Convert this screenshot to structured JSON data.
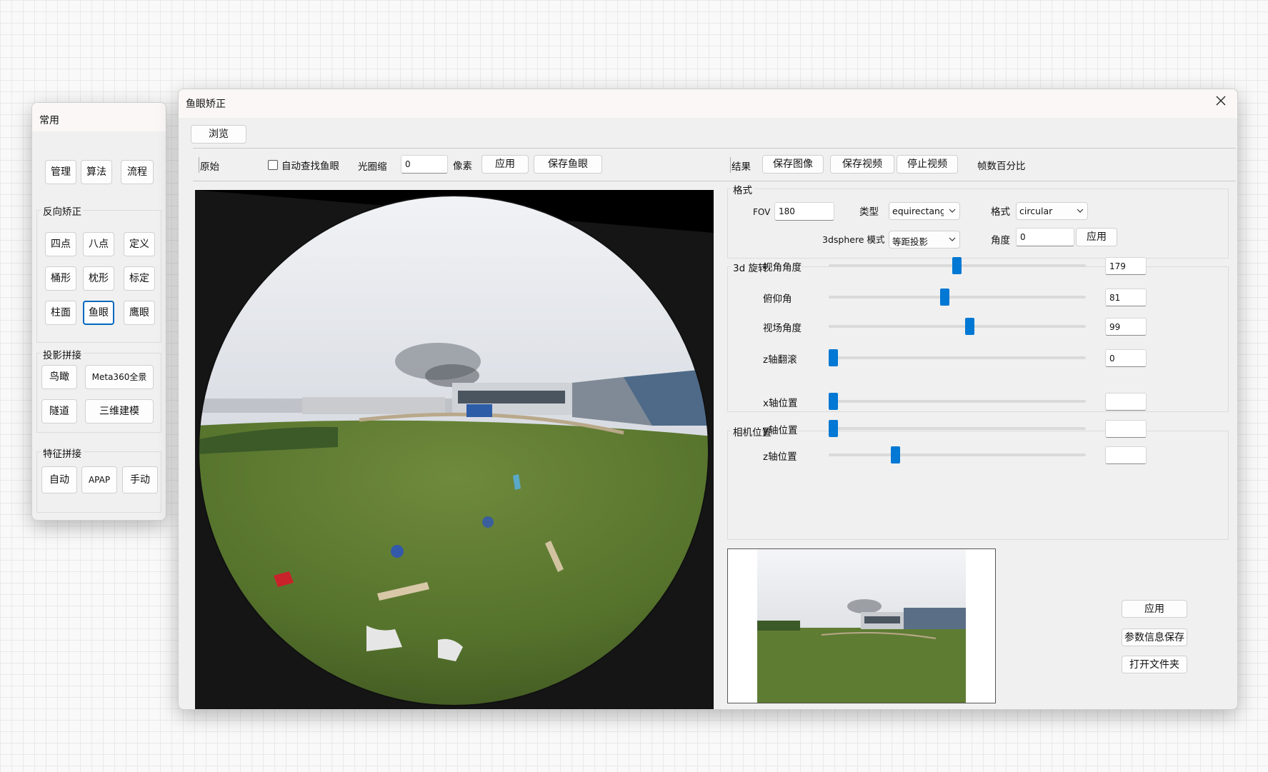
{
  "sidebar": {
    "title": "常用",
    "buttons_top": [
      "管理",
      "算法",
      "流程"
    ],
    "reverse": {
      "title": "反向矫正",
      "buttons": [
        "四点",
        "八点",
        "定义",
        "桶形",
        "枕形",
        "标定",
        "柱面",
        "鱼眼",
        "鹰眼"
      ],
      "selected": "鱼眼"
    },
    "projection": {
      "title": "投影拼接",
      "buttons": [
        "鸟瞰",
        "Meta360全景",
        "隧道",
        "三维建模"
      ]
    },
    "feature": {
      "title": "特征拼接",
      "buttons": [
        "自动",
        "APAP",
        "手动"
      ]
    }
  },
  "main": {
    "title": "鱼眼矫正",
    "browse_label": "浏览",
    "toolbar": {
      "original_label": "原始",
      "auto_find_label": "自动查找鱼眼",
      "aperture_label": "光圈缩",
      "aperture_value": "0",
      "pixel_label": "像素",
      "apply_label": "应用",
      "save_fisheye_label": "保存鱼眼",
      "result_label": "结果",
      "save_image_label": "保存图像",
      "save_video_label": "保存视频",
      "stop_video_label": "停止视频",
      "frame_pct_label": "帧数百分比"
    },
    "format": {
      "title": "格式",
      "fov_label": "FOV",
      "fov_value": "180",
      "type_label": "类型",
      "type_value": "equirectangle",
      "format_label": "格式",
      "format_value": "circular",
      "sphere_label": "3dsphere 模式",
      "sphere_value": "等距投影",
      "angle_label": "角度",
      "angle_value": "0",
      "apply_label": "应用"
    },
    "rotation": {
      "title": "3d 旋转",
      "sliders": [
        {
          "label": "视角角度",
          "value": "179",
          "pos": 0.496
        },
        {
          "label": "俯仰角",
          "value": "81",
          "pos": 0.449
        },
        {
          "label": "视场角度",
          "value": "99",
          "pos": 0.548
        },
        {
          "label": "z轴翻滚",
          "value": "0",
          "pos": 0.017
        }
      ]
    },
    "camera": {
      "title": "相机位置",
      "sliders": [
        {
          "label": "x轴位置",
          "value": "",
          "pos": 0.017
        },
        {
          "label": "y轴位置",
          "value": "",
          "pos": 0.017
        },
        {
          "label": "z轴位置",
          "value": "",
          "pos": 0.259
        }
      ]
    },
    "bottom": {
      "apply_label": "应用",
      "save_params_label": "参数信息保存",
      "open_folder_label": "打开文件夹"
    }
  }
}
